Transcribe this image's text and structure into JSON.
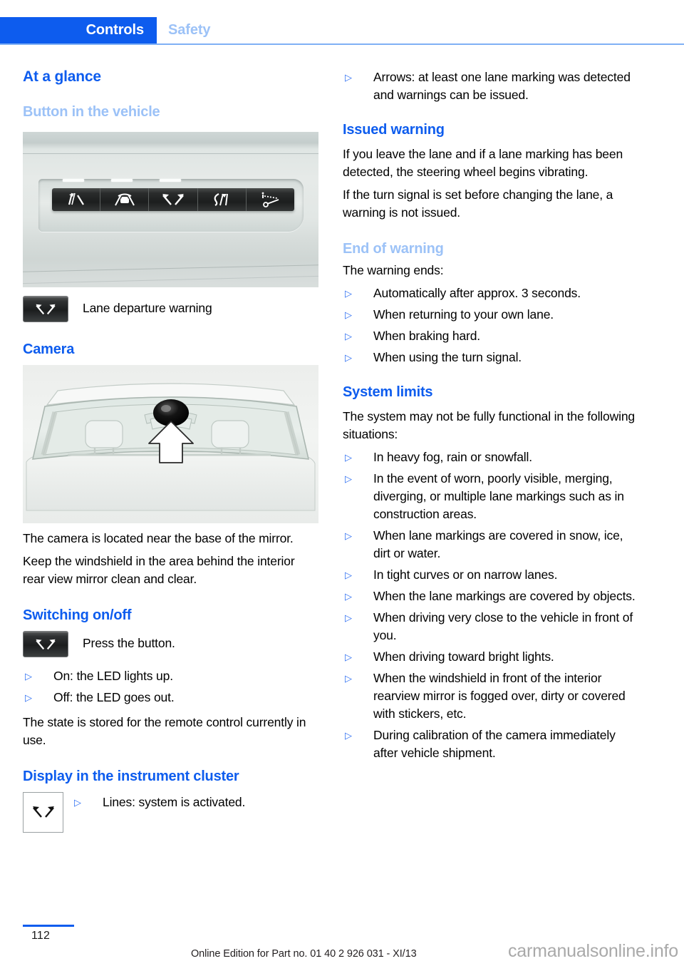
{
  "header": {
    "active_tab": "Controls",
    "inactive_tab": "Safety",
    "accent_color": "#0d5cee",
    "muted_accent_color": "#9cc2f7"
  },
  "left_column": {
    "title": "At a glance",
    "section_button": {
      "heading": "Button in the vehicle",
      "figure_name": "vehicle-button-panel",
      "icon_caption": "Lane departure warning"
    },
    "section_camera": {
      "heading": "Camera",
      "figure_name": "windshield-camera-location",
      "paragraphs": [
        "The camera is located near the base of the mirror.",
        "Keep the windshield in the area behind the interior rear view mirror clean and clear."
      ]
    },
    "section_switching": {
      "heading": "Switching on/off",
      "icon_caption": "Press the button.",
      "bullets": [
        "On: the LED lights up.",
        "Off: the LED goes out."
      ],
      "paragraph": "The state is stored for the remote control currently in use."
    },
    "section_cluster": {
      "heading": "Display in the instrument cluster",
      "bullets": [
        "Lines: system is activated."
      ]
    }
  },
  "right_column": {
    "lead_bullets": [
      "Arrows: at least one lane marking was detected and warnings can be issued."
    ],
    "section_issued": {
      "heading": "Issued warning",
      "paragraphs": [
        "If you leave the lane and if a lane marking has been detected, the steering wheel begins vibrating.",
        "If the turn signal is set before changing the lane, a warning is not issued."
      ]
    },
    "section_end": {
      "heading": "End of warning",
      "intro": "The warning ends:",
      "bullets": [
        "Automatically after approx. 3 seconds.",
        "When returning to your own lane.",
        "When braking hard.",
        "When using the turn signal."
      ]
    },
    "section_limits": {
      "heading": "System limits",
      "intro": "The system may not be fully functional in the following situations:",
      "bullets": [
        "In heavy fog, rain or snowfall.",
        "In the event of worn, poorly visible, merging, diverging, or multiple lane markings such as in construction areas.",
        "When lane markings are covered in snow, ice, dirt or water.",
        "In tight curves or on narrow lanes.",
        "When the lane markings are covered by objects.",
        "When driving very close to the vehicle in front of you.",
        "When driving toward bright lights.",
        "When the windshield in front of the interior rearview mirror is fogged over, dirty or covered with stickers, etc.",
        "During calibration of the camera immediately after vehicle shipment."
      ]
    }
  },
  "bullet_mark": "▷",
  "footer": {
    "page_number": "112",
    "edition": "Online Edition for Part no. 01 40 2 926 031 - XI/13",
    "watermark": "carmanualsonline.info"
  }
}
